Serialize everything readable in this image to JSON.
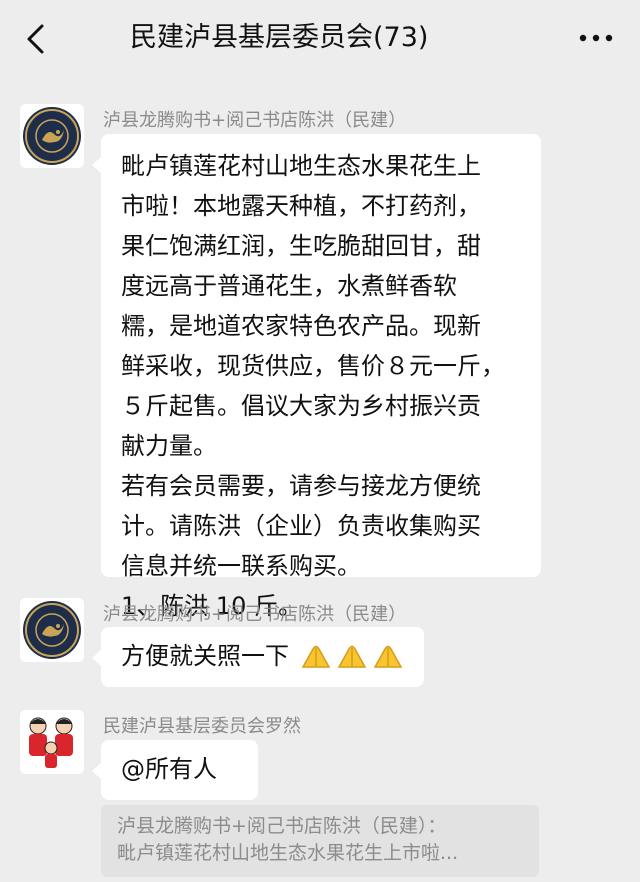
{
  "header": {
    "title": "民建泸县基层委员会(73)",
    "back_icon": "chevron-left-icon",
    "more_icon": "more-dots-icon"
  },
  "messages": [
    {
      "sender": "泸县龙腾购书+阅己书店陈洪（民建）",
      "avatar": "bookstore-logo",
      "lines": [
        "毗卢镇莲花村山地生态水果花生上",
        "市啦！本地露天种植，不打药剂，",
        "果仁饱满红润，生吃脆甜回甘，甜",
        "度远高于普通花生，水煮鲜香软",
        "糯，是地道农家特色农产品。现新",
        "鲜采收，现货供应，售价８元一斤，",
        "５斤起售。倡议大家为乡村振兴贡",
        "献力量。",
        "若有会员需要，请参与接龙方便统",
        "计。请陈洪（企业）负责收集购买",
        "信息并统一联系购买。",
        "1、陈洪 10 斤。"
      ]
    },
    {
      "sender": "泸县龙腾购书+阅己书店陈洪（民建）",
      "avatar": "bookstore-logo",
      "text": "方便就关照一下",
      "emoji": "folded-hands-icon",
      "emoji_count": 3
    },
    {
      "sender": "民建泸县基层委员会罗然",
      "avatar": "family-cartoon-avatar",
      "text": "@所有人"
    }
  ],
  "quote": {
    "line1": "泸县龙腾购书+阅己书店陈洪（民建）：",
    "line2": "毗卢镇莲花村山地生态水果花生上市啦..."
  },
  "colors": {
    "background": "#ededed",
    "bubble": "#ffffff",
    "quote_bg": "#e2e2e2",
    "sender_text": "#8a8a8a"
  }
}
